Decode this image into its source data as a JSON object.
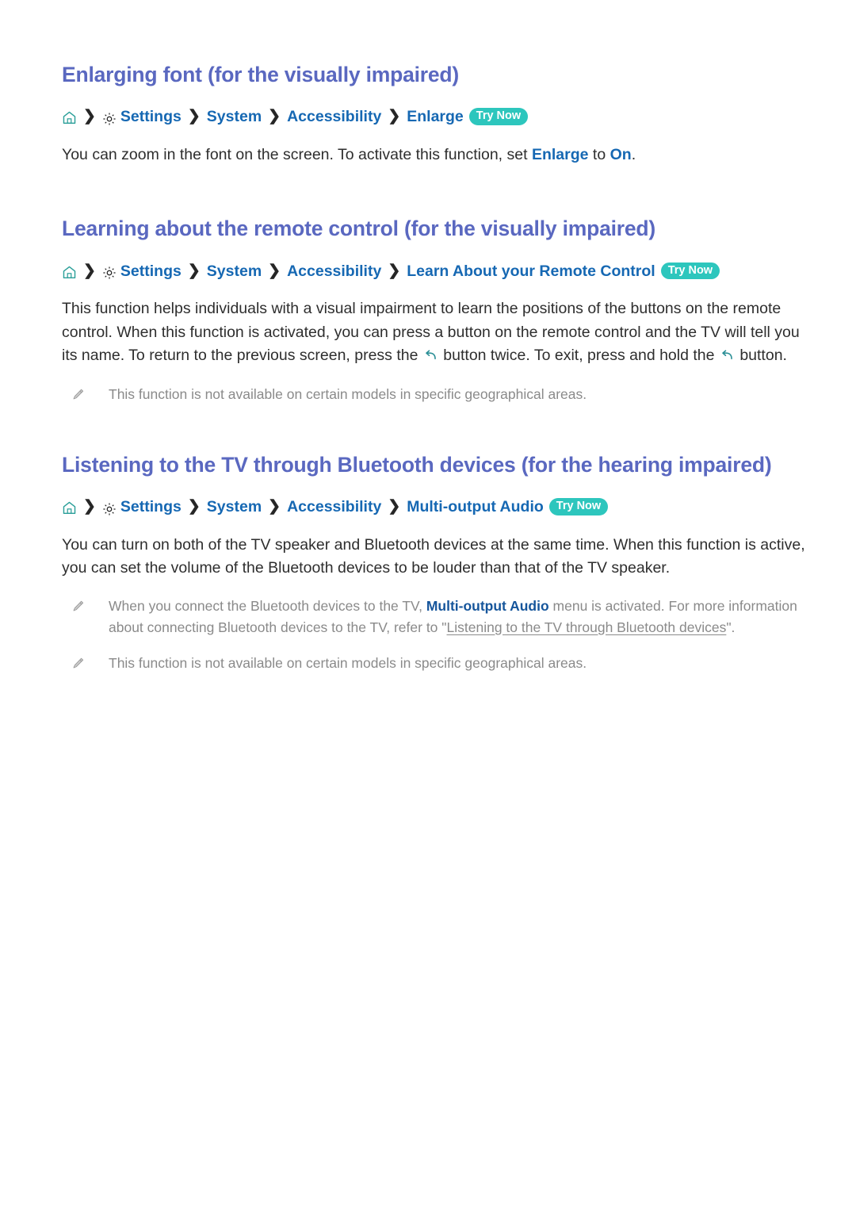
{
  "page": {
    "background": "#ffffff",
    "heading_color": "#5a68c0",
    "link_color": "#1668b3",
    "badge_color": "#2dc6bd",
    "note_color": "#8a8a8a"
  },
  "sections": [
    {
      "title": "Enlarging font (for the visually impaired)",
      "breadcrumb": {
        "home_icon": "home-icon",
        "gear_icon": "gear-icon",
        "items": [
          "Settings",
          "System",
          "Accessibility",
          "Enlarge"
        ],
        "separator": "›",
        "badge": "Try Now"
      },
      "body": {
        "part1": "You can zoom in the font on the screen. To activate this function, set ",
        "kw1": "Enlarge",
        "part2": " to ",
        "kw2": "On",
        "part3": "."
      },
      "notes": []
    },
    {
      "title": "Learning about the remote control (for the visually impaired)",
      "breadcrumb": {
        "home_icon": "home-icon",
        "gear_icon": "gear-icon",
        "items": [
          "Settings",
          "System",
          "Accessibility",
          "Learn About your Remote Control"
        ],
        "separator": "›",
        "badge": "Try Now"
      },
      "body": {
        "part1": "This function helps individuals with a visual impairment to learn the positions of the buttons on the remote control. When this function is activated, you can press a button on the remote control and the TV will tell you its name. To return to the previous screen, press the ",
        "icon1": "return-arrow-icon",
        "part2": " button twice. To exit, press and hold the ",
        "icon2": "return-arrow-icon",
        "part3": " button."
      },
      "notes": [
        {
          "icon": "pencil-icon",
          "text": "This function is not available on certain models in specific geographical areas."
        }
      ]
    },
    {
      "title": "Listening to the TV through Bluetooth devices (for the hearing impaired)",
      "breadcrumb": {
        "home_icon": "home-icon",
        "gear_icon": "gear-icon",
        "items": [
          "Settings",
          "System",
          "Accessibility",
          "Multi-output Audio"
        ],
        "separator": "›",
        "badge": "Try Now"
      },
      "body": {
        "full": "You can turn on both of the TV speaker and Bluetooth devices at the same time. When this function is active, you can set the volume of the Bluetooth devices to be louder than that of the TV speaker."
      },
      "notes": [
        {
          "icon": "pencil-icon",
          "part1": "When you connect the Bluetooth devices to the TV, ",
          "kw": "Multi-output Audio",
          "part2": " menu is activated. For more information about connecting Bluetooth devices to the TV, refer to \"",
          "link": "Listening to the TV through Bluetooth devices",
          "part3": "\"."
        },
        {
          "icon": "pencil-icon",
          "text": "This function is not available on certain models in specific geographical areas."
        }
      ]
    }
  ]
}
